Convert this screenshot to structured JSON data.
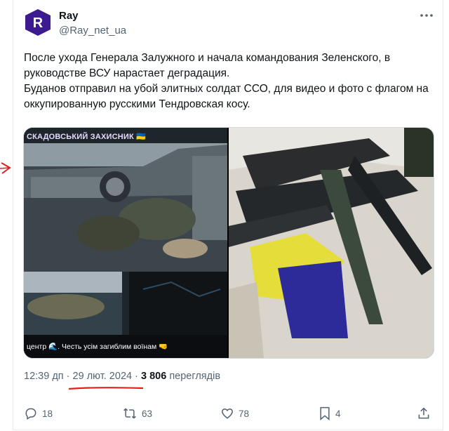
{
  "author": {
    "avatar_letter": "R",
    "name": "Ray",
    "handle": "@Ray_net_ua"
  },
  "tweet": {
    "paragraphs": [
      "После ухода Генерала Залужного и начала командования Зеленского, в руководстве ВСУ нарастает деградация.",
      "Буданов отправил на убой элитных солдат ССО, для видео и фото с флагом на оккупированную русскими Тендровская косу."
    ]
  },
  "media": {
    "left_caption_top": "СКАДОВСЬКИЙ ЗАХИСНИК 🇺🇦",
    "left_caption_bottom": "центр 🌊. Честь усім загиблим воїнам 🤜"
  },
  "meta": {
    "time": "12:39 дп",
    "separator": "·",
    "date": "29 лют. 2024",
    "views_count": "3 806",
    "views_label": "переглядів"
  },
  "actions": {
    "replies": "18",
    "reposts": "63",
    "likes": "78",
    "bookmarks": "4"
  },
  "colors": {
    "avatar_bg": "#3b1b8f",
    "text_secondary": "#536471",
    "annotation_red": "#e0201e"
  }
}
